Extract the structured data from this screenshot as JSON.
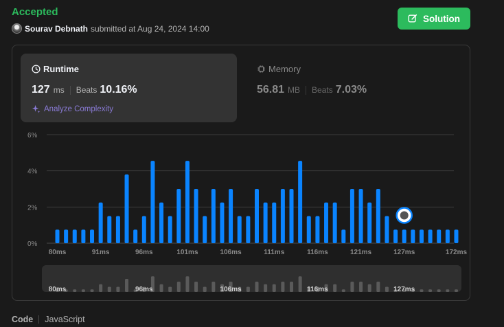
{
  "status": "Accepted",
  "submitter": {
    "name": "Sourav Debnath",
    "rest": "submitted at Aug 24, 2024 14:00"
  },
  "solution_button": "Solution",
  "runtime": {
    "title": "Runtime",
    "value": "127",
    "unit": "ms",
    "beats_label": "Beats",
    "beats": "10.16%",
    "analyze": "Analyze Complexity"
  },
  "memory": {
    "title": "Memory",
    "value": "56.81",
    "unit": "MB",
    "beats_label": "Beats",
    "beats": "7.03%"
  },
  "colors": {
    "accent": "#2cbb5d",
    "bar": "#0a84ff",
    "overview_bar": "#5a5a5a"
  },
  "footer": {
    "label": "Code",
    "language": "JavaScript"
  },
  "chart_data": {
    "type": "bar",
    "ylabel": "",
    "xlabel": "",
    "ylim": [
      0,
      6
    ],
    "yticks": [
      "0%",
      "2%",
      "4%",
      "6%"
    ],
    "ytick_values": [
      0,
      2,
      4,
      6
    ],
    "xtick_labels": [
      "80ms",
      "91ms",
      "96ms",
      "101ms",
      "106ms",
      "111ms",
      "116ms",
      "121ms",
      "127ms",
      "172ms"
    ],
    "xtick_bar_index": [
      0,
      5,
      10,
      15,
      20,
      25,
      30,
      35,
      40,
      46
    ],
    "overview_labels": [
      "80ms",
      "96ms",
      "106ms",
      "116ms",
      "127ms"
    ],
    "overview_label_bar_index": [
      0,
      10,
      20,
      30,
      40
    ],
    "values": [
      0.75,
      0.75,
      0.75,
      0.75,
      0.75,
      2.25,
      1.5,
      1.5,
      3.8,
      0.75,
      1.5,
      4.55,
      2.25,
      1.5,
      3.0,
      4.55,
      3.0,
      1.5,
      3.0,
      2.25,
      3.0,
      1.5,
      1.5,
      3.0,
      2.25,
      2.25,
      3.0,
      3.0,
      4.55,
      1.5,
      1.5,
      2.25,
      2.25,
      0.75,
      3.0,
      3.0,
      2.25,
      3.0,
      1.5,
      0.75,
      0.75,
      0.75,
      0.75,
      0.75,
      0.75,
      0.75,
      0.75
    ],
    "highlight_bar_index": 40,
    "highlight_value": 1.5,
    "grid": true
  }
}
